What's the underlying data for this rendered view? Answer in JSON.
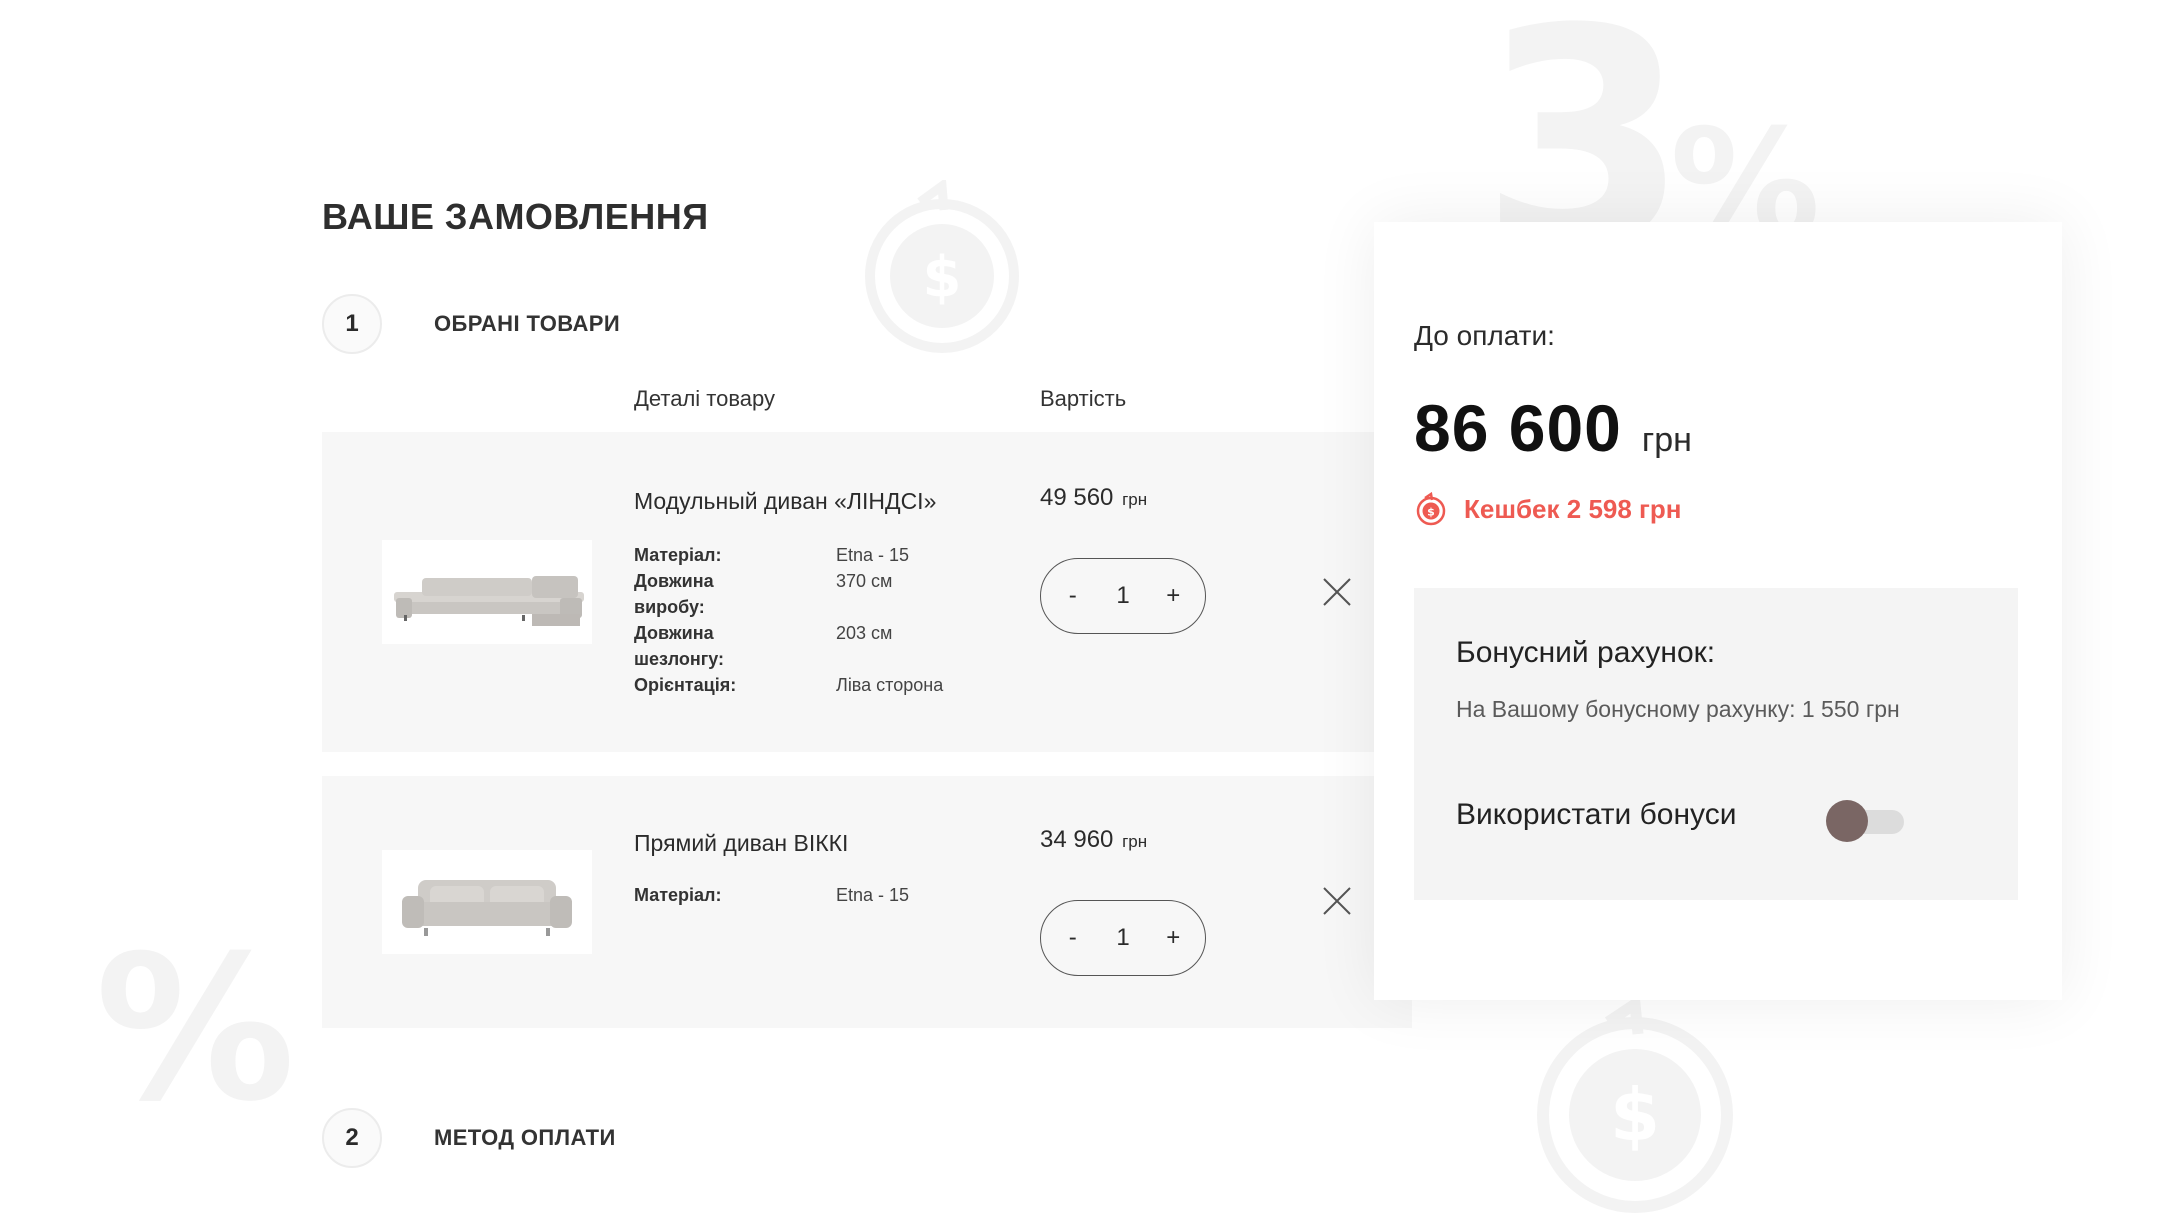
{
  "page": {
    "title": "ВАШЕ ЗАМОВЛЕННЯ"
  },
  "steps": [
    {
      "number": "1",
      "title": "ОБРАНІ ТОВАРИ"
    },
    {
      "number": "2",
      "title": "МЕТОД ОПЛАТИ"
    }
  ],
  "table": {
    "details_header": "Деталі товару",
    "price_header": "Вартість"
  },
  "products": [
    {
      "name": "Модульный диван «ЛІНДСІ»",
      "price": "49 560",
      "currency": "грн",
      "quantity": "1",
      "minus": "-",
      "plus": "+",
      "specs": [
        {
          "key": "Матеріал:",
          "value": "Etna - 15"
        },
        {
          "key": "Довжина виробу:",
          "value": "370 см"
        },
        {
          "key": "Довжина шезлонгу:",
          "value": "203 см"
        },
        {
          "key": "Орієнтація:",
          "value": "Ліва сторона"
        }
      ]
    },
    {
      "name": "Прямий диван ВІККІ",
      "price": "34 960",
      "currency": "грн",
      "quantity": "1",
      "minus": "-",
      "plus": "+",
      "specs": [
        {
          "key": "Матеріал:",
          "value": "Etna - 15"
        }
      ]
    }
  ],
  "summary": {
    "label": "До оплати:",
    "amount": "86 600",
    "currency": "грн",
    "cashback": "Кешбек 2 598 грн",
    "bonus": {
      "title": "Бонусний рахунок:",
      "balance_text": "На Вашому бонусному рахунку: 1 550 грн",
      "use_label": "Використати бонуси",
      "use_enabled": false
    }
  },
  "background": {
    "big_number": "3",
    "percent_sign": "%"
  },
  "icons": {
    "remove": "close-icon",
    "cashback": "cashback-coin-icon",
    "decor": "dollar-coin-icon"
  },
  "colors": {
    "accent": "#ee5a52",
    "toggle_knob": "#7a6664",
    "row_bg": "#f7f7f7",
    "bonus_bg": "#f4f4f4"
  }
}
